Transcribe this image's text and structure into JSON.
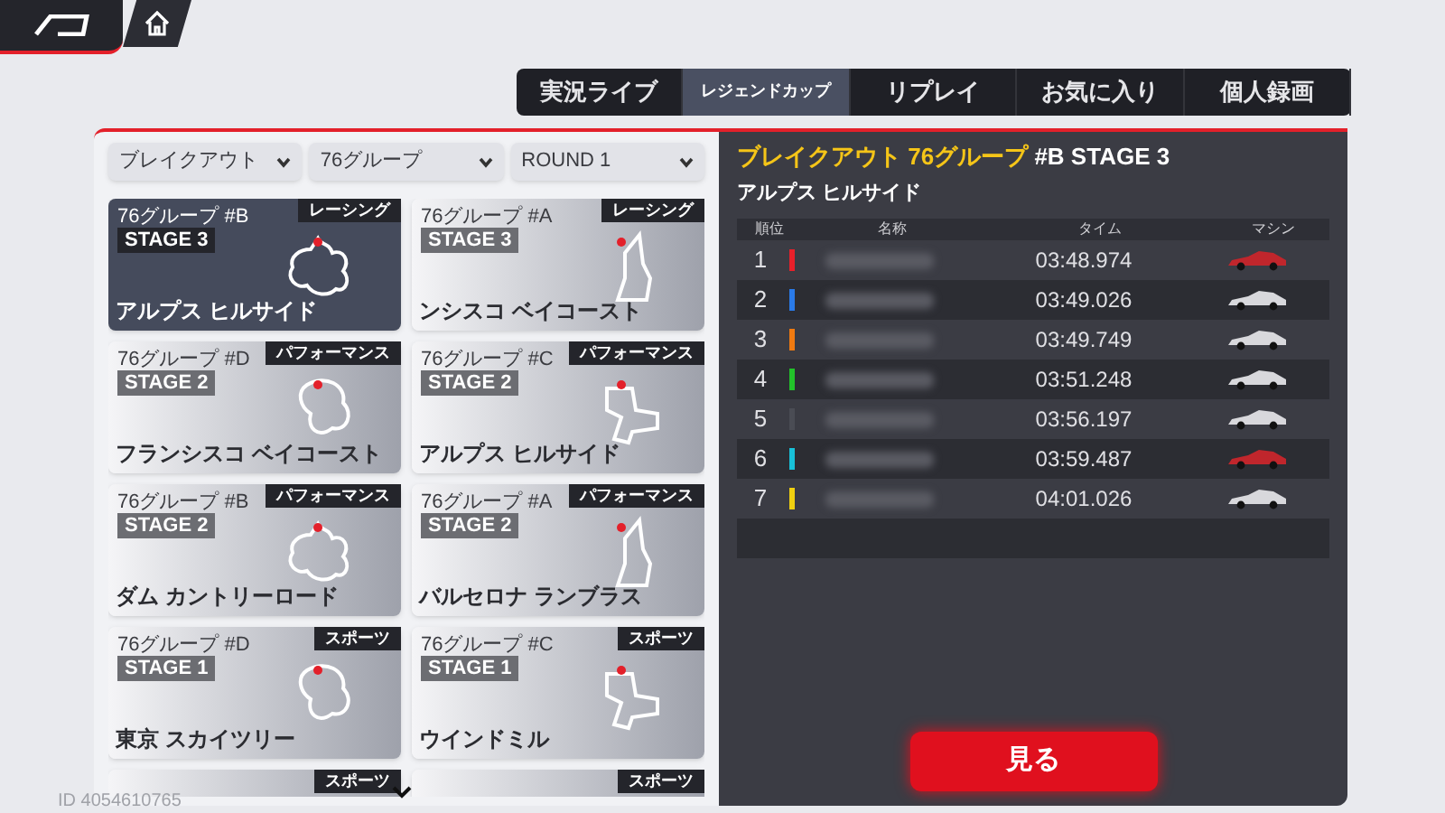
{
  "tabs": [
    {
      "label": "実況ライブ",
      "selected": false
    },
    {
      "label": "レジェンドカップ",
      "selected": true
    },
    {
      "label": "リプレイ",
      "selected": false
    },
    {
      "label": "お気に入り",
      "selected": false
    },
    {
      "label": "個人録画",
      "selected": false
    }
  ],
  "filters": [
    {
      "value": "ブレイクアウト"
    },
    {
      "value": "76グループ"
    },
    {
      "value": "ROUND 1"
    }
  ],
  "stages": [
    {
      "group": "76グループ  #B",
      "stage": "STAGE 3",
      "tag": "レーシング",
      "track": "アルプス  ヒルサイド",
      "selected": true
    },
    {
      "group": "76グループ  #A",
      "stage": "STAGE 3",
      "tag": "レーシング",
      "track": "ンシスコ  ベイコースト",
      "selected": false
    },
    {
      "group": "76グループ  #D",
      "stage": "STAGE 2",
      "tag": "パフォーマンス",
      "track": "フランシスコ  ベイコースト",
      "selected": false
    },
    {
      "group": "76グループ  #C",
      "stage": "STAGE 2",
      "tag": "パフォーマンス",
      "track": "アルプス  ヒルサイド",
      "selected": false
    },
    {
      "group": "76グループ  #B",
      "stage": "STAGE 2",
      "tag": "パフォーマンス",
      "track": "ダム  カントリーロード",
      "selected": false
    },
    {
      "group": "76グループ  #A",
      "stage": "STAGE 2",
      "tag": "パフォーマンス",
      "track": "バルセロナ  ランブラス",
      "selected": false
    },
    {
      "group": "76グループ  #D",
      "stage": "STAGE 1",
      "tag": "スポーツ",
      "track": "東京  スカイツリー",
      "selected": false
    },
    {
      "group": "76グループ  #C",
      "stage": "STAGE 1",
      "tag": "スポーツ",
      "track": "ウインドミル",
      "selected": false
    },
    {
      "tag": "スポーツ",
      "selected": false
    },
    {
      "tag": "スポーツ",
      "selected": false
    }
  ],
  "player_id": "ID 4054610765",
  "detail": {
    "title_highlight": "ブレイクアウト  76グループ",
    "title_rest": "#B  STAGE 3",
    "subtitle": "アルプス  ヒルサイド",
    "columns": [
      "順位",
      "名称",
      "タイム",
      "マシン"
    ],
    "rows": [
      {
        "rank": "1",
        "color": "#e8202a",
        "time": "03:48.974"
      },
      {
        "rank": "2",
        "color": "#2a7ae8",
        "time": "03:49.026"
      },
      {
        "rank": "3",
        "color": "#f07a10",
        "time": "03:49.749"
      },
      {
        "rank": "4",
        "color": "#22c22a",
        "time": "03:51.248"
      },
      {
        "rank": "5",
        "color": "#4a4c54",
        "time": "03:56.197"
      },
      {
        "rank": "6",
        "color": "#18c0d8",
        "time": "03:59.487"
      },
      {
        "rank": "7",
        "color": "#f0d010",
        "time": "04:01.026"
      }
    ],
    "watch_button": "見る"
  }
}
